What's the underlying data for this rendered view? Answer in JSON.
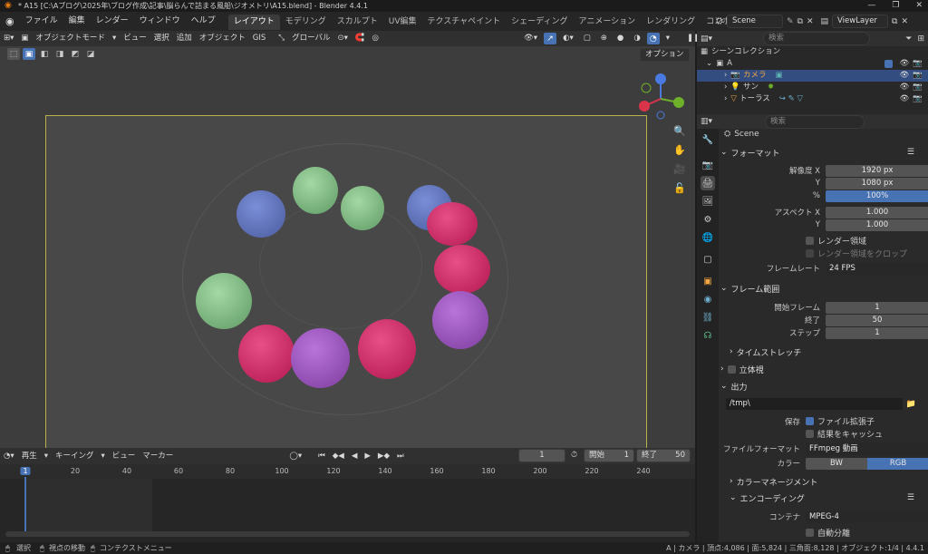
{
  "window": {
    "title": "* A15 [C:\\Aブログ\\2025年\\ブログ作成\\記事\\脳らんで詰まる風船\\ジオメトリ\\A15.blend] - Blender 4.4.1"
  },
  "menu": {
    "items": [
      "ファイル",
      "編集",
      "レンダー",
      "ウィンドウ",
      "ヘルプ"
    ],
    "workspaces": [
      "レイアウト",
      "モデリング",
      "スカルプト",
      "UV編集",
      "テクスチャペイント",
      "シェーディング",
      "アニメーション",
      "レンダリング",
      "コンポジティング"
    ],
    "scene": "Scene",
    "view_layer": "ViewLayer"
  },
  "viewport_header": {
    "mode": "オブジェクトモード",
    "view": "ビュー",
    "select": "選択",
    "add": "追加",
    "object": "オブジェクト",
    "gis": "GIS",
    "orientation": "グローバル",
    "options": "オプション"
  },
  "outliner": {
    "search_placeholder": "検索",
    "root": "シーンコレクション",
    "collection": "A",
    "items": [
      "カメラ",
      "サン",
      "トーラス"
    ]
  },
  "props": {
    "search_placeholder": "検索",
    "scene": "Scene",
    "format": {
      "title": "フォーマット",
      "res_x_label": "解像度 X",
      "res_x": "1920 px",
      "res_y_label": "Y",
      "res_y": "1080 px",
      "pct_label": "%",
      "pct": "100%",
      "aspect_x_label": "アスペクト X",
      "aspect_x": "1.000",
      "aspect_y_label": "Y",
      "aspect_y": "1.000",
      "border": "レンダー領域",
      "crop": "レンダー領域をクロップ",
      "fps_label": "フレームレート",
      "fps": "24 FPS"
    },
    "frame_range": {
      "title": "フレーム範囲",
      "start_label": "開始フレーム",
      "start": "1",
      "end_label": "終了",
      "end": "50",
      "step_label": "ステップ",
      "step": "1",
      "stretch": "タイムストレッチ"
    },
    "stereo": "立体視",
    "output": {
      "title": "出力",
      "path": "/tmp\\",
      "save_label": "保存",
      "ext": "ファイル拡張子",
      "cache": "結果をキャッシュ",
      "format_label": "ファイルフォーマット",
      "format": "FFmpeg 動画",
      "color_label": "カラー",
      "bw": "BW",
      "rgb": "RGB",
      "color_mgmt": "カラーマネージメント",
      "encoding": "エンコーディング",
      "container_label": "コンテナ",
      "container": "MPEG-4",
      "autosplit": "自動分離"
    }
  },
  "timeline": {
    "play": "再生",
    "keying": "キーイング",
    "view": "ビュー",
    "marker": "マーカー",
    "current": "1",
    "start_label": "開始",
    "start": "1",
    "end_label": "終了",
    "end": "50",
    "ticks": [
      "1",
      "20",
      "40",
      "60",
      "80",
      "100",
      "120",
      "140",
      "160",
      "180",
      "200",
      "220",
      "240"
    ]
  },
  "status": {
    "select": "選択",
    "pan": "視点の移動",
    "context": "コンテクストメニュー",
    "stats": "A | カメラ | 頂点:4,086 | 面:5,824 | 三角面:8,128 | オブジェクト:1/4 | 4.4.1"
  }
}
